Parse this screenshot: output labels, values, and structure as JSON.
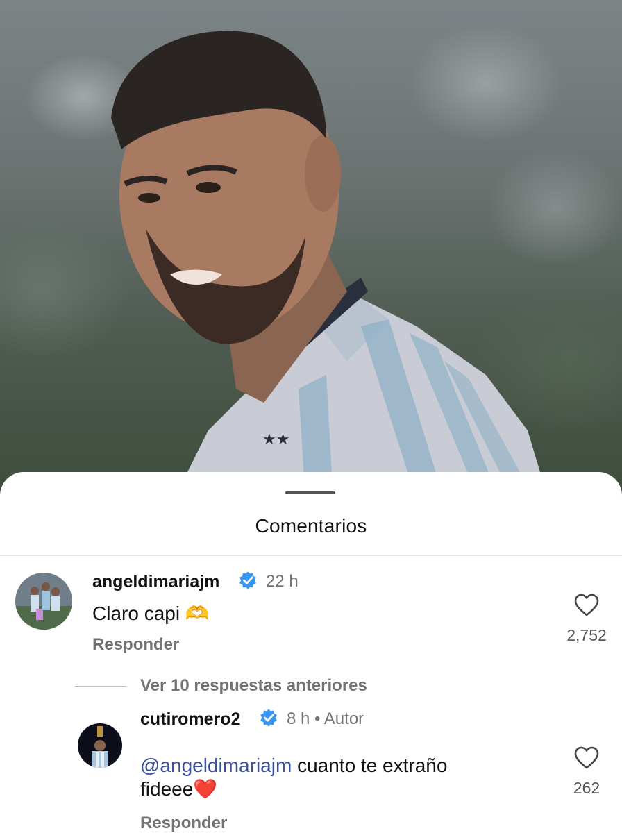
{
  "sheet": {
    "title": "Comentarios"
  },
  "comments": [
    {
      "username": "angeldimariajm",
      "time": "22 h",
      "text": "Claro capi 🫶",
      "reply_label": "Responder",
      "likes": "2,752"
    }
  ],
  "view_more": "Ver 10 respuestas anteriores",
  "reply": {
    "username": "cutiromero2",
    "time": "8 h",
    "separator": "•",
    "author_badge": "Autor",
    "mention": "@angeldimariajm",
    "text_after_mention": " cuanto te extraño",
    "text_line2": "fideee❤️",
    "reply_label": "Responder",
    "likes": "262"
  },
  "colors": {
    "verified_badge": "#3897f0",
    "mention": "#3a4f9b",
    "muted_text": "#737373"
  },
  "icons": {
    "verified": "verified-badge-icon",
    "like": "heart-outline-icon"
  }
}
